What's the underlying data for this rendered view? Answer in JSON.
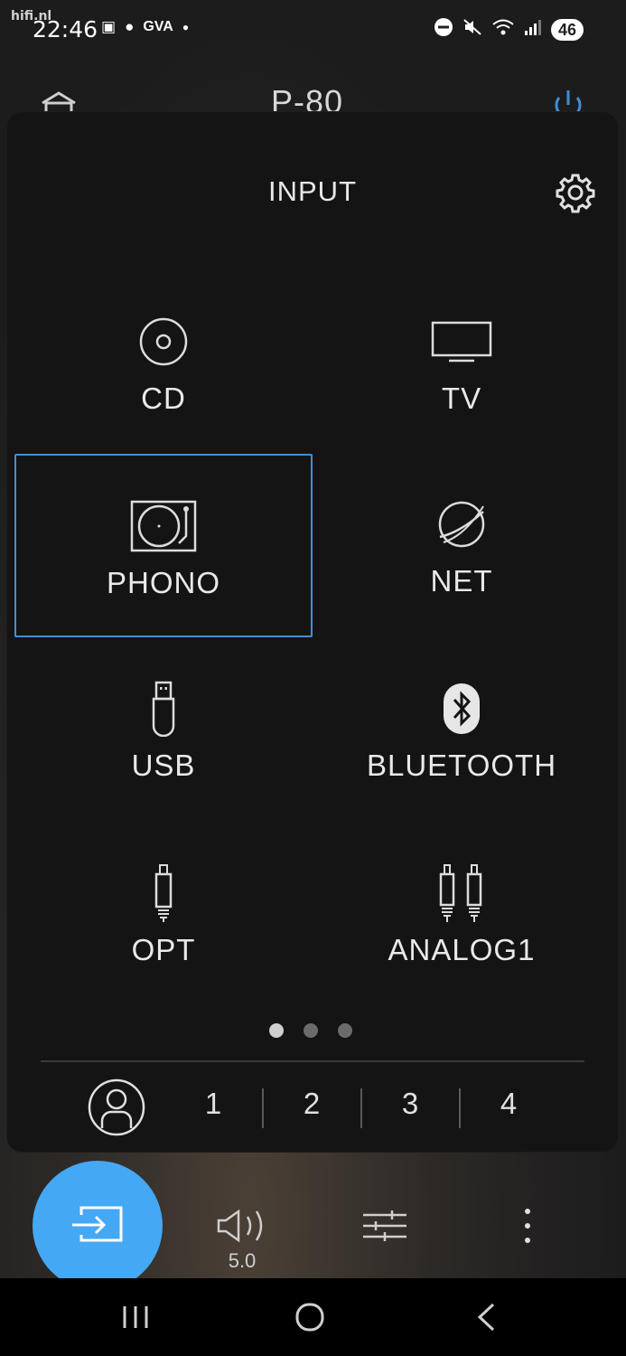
{
  "status_bar": {
    "watermark": "hifi.nl",
    "time": "22:46",
    "carrier": "GVA",
    "battery": "46"
  },
  "app_header": {
    "title": "P-80"
  },
  "panel": {
    "title": "INPUT",
    "inputs": [
      {
        "label": "CD",
        "icon": "disc-icon"
      },
      {
        "label": "TV",
        "icon": "tv-icon"
      },
      {
        "label": "PHONO",
        "icon": "turntable-icon",
        "selected": true
      },
      {
        "label": "NET",
        "icon": "globe-icon"
      },
      {
        "label": "USB",
        "icon": "usb-stick-icon"
      },
      {
        "label": "BLUETOOTH",
        "icon": "bluetooth-icon"
      },
      {
        "label": "OPT",
        "icon": "optical-plug-icon"
      },
      {
        "label": "ANALOG1",
        "icon": "rca-plugs-icon"
      }
    ],
    "page_count": 3,
    "current_page": 1,
    "zones": [
      "1",
      "2",
      "3",
      "4"
    ]
  },
  "bottom_bar": {
    "volume": "5.0"
  },
  "colors": {
    "accent": "#44a8f5",
    "selected_border": "#3f8fd9",
    "panel": "#141414"
  }
}
